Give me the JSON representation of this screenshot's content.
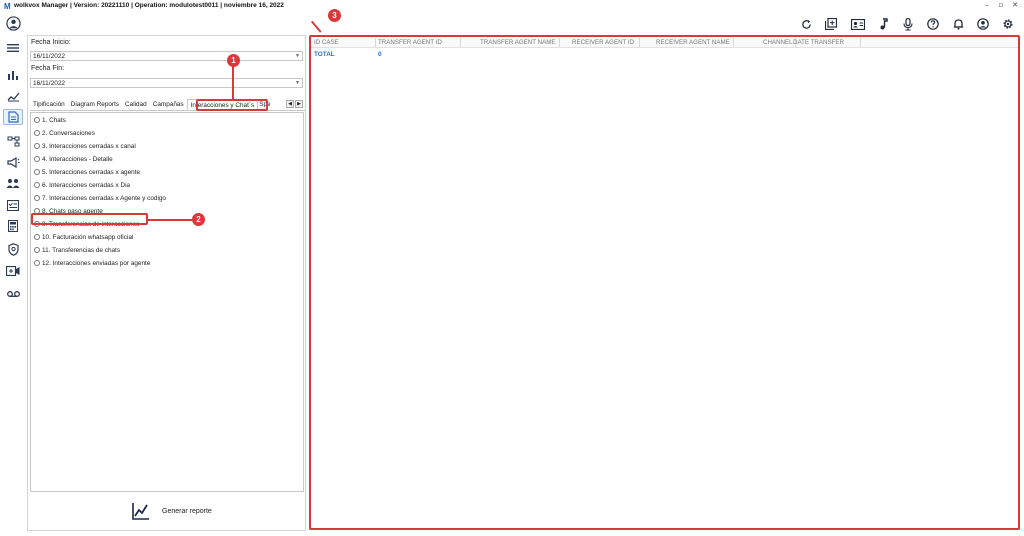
{
  "window": {
    "logo": "M",
    "title": "wolkvox Manager  | Version: 20221110 |  Operation: modulotest0011  |  noviembre 16, 2022",
    "controls": [
      "–",
      "▫",
      "✕"
    ]
  },
  "sidebar": {
    "items": [
      "avatar-icon",
      "menu-icon",
      "bar-chart-icon",
      "trend-icon",
      "report-icon",
      "flow-icon",
      "campaign-icon",
      "users-icon",
      "checklist-icon",
      "calculator-icon",
      "security-icon",
      "video-icon",
      "voicemail-icon"
    ],
    "active": "report-icon"
  },
  "toolbar": {
    "icons": [
      "refresh-icon",
      "copy-icon",
      "id-card-icon",
      "music-icon",
      "microphone-icon",
      "help-icon",
      "bell-icon",
      "user-icon",
      "settings-icon"
    ]
  },
  "filters": {
    "start_label": "Fecha Inicio:",
    "start_value": "16/11/2022",
    "end_label": "Fecha Fin:",
    "end_value": "16/11/2022"
  },
  "tabs": [
    {
      "label": "Tipificación",
      "selected": false
    },
    {
      "label": "Diagram Reports",
      "selected": false
    },
    {
      "label": "Calidad",
      "selected": false
    },
    {
      "label": "Campañas",
      "selected": false
    },
    {
      "label": "Interacciones y Chat´s",
      "selected": true
    },
    {
      "label": "Spe",
      "selected": false
    }
  ],
  "reports": [
    {
      "label": "1. Chats",
      "checked": false
    },
    {
      "label": "2. Conversaciones",
      "checked": false
    },
    {
      "label": "3. Interacciones cerradas x canal",
      "checked": false
    },
    {
      "label": "4. Interacciones - Detalle",
      "checked": false
    },
    {
      "label": "5. Interacciones cerradas x agente",
      "checked": false
    },
    {
      "label": "6. Interacciones cerradas x Dia",
      "checked": false
    },
    {
      "label": "7. Interacciones cerradas x Agente y codigo",
      "checked": false
    },
    {
      "label": "8. Chats paso agente",
      "checked": false
    },
    {
      "label": "9. Transferencias de interacciones",
      "checked": true
    },
    {
      "label": "10. Facturación whatsapp oficial",
      "checked": false
    },
    {
      "label": "11. Transferencias de chats",
      "checked": false
    },
    {
      "label": "12. Interacciones enviadas por agente",
      "checked": false
    }
  ],
  "generate": {
    "label": "Generar reporte"
  },
  "grid": {
    "columns": [
      "ID CASE",
      "TRANSFER AGENT ID",
      "TRANSFER AGENT NAME",
      "RECEIVER AGENT ID",
      "RECEIVER AGENT NAME",
      "CHANNEL",
      "DATE TRANSFER"
    ],
    "total_label": "TOTAL",
    "total_value": "0"
  },
  "annotations": {
    "markers": [
      "1",
      "2",
      "3"
    ],
    "color": "#d9393b"
  }
}
